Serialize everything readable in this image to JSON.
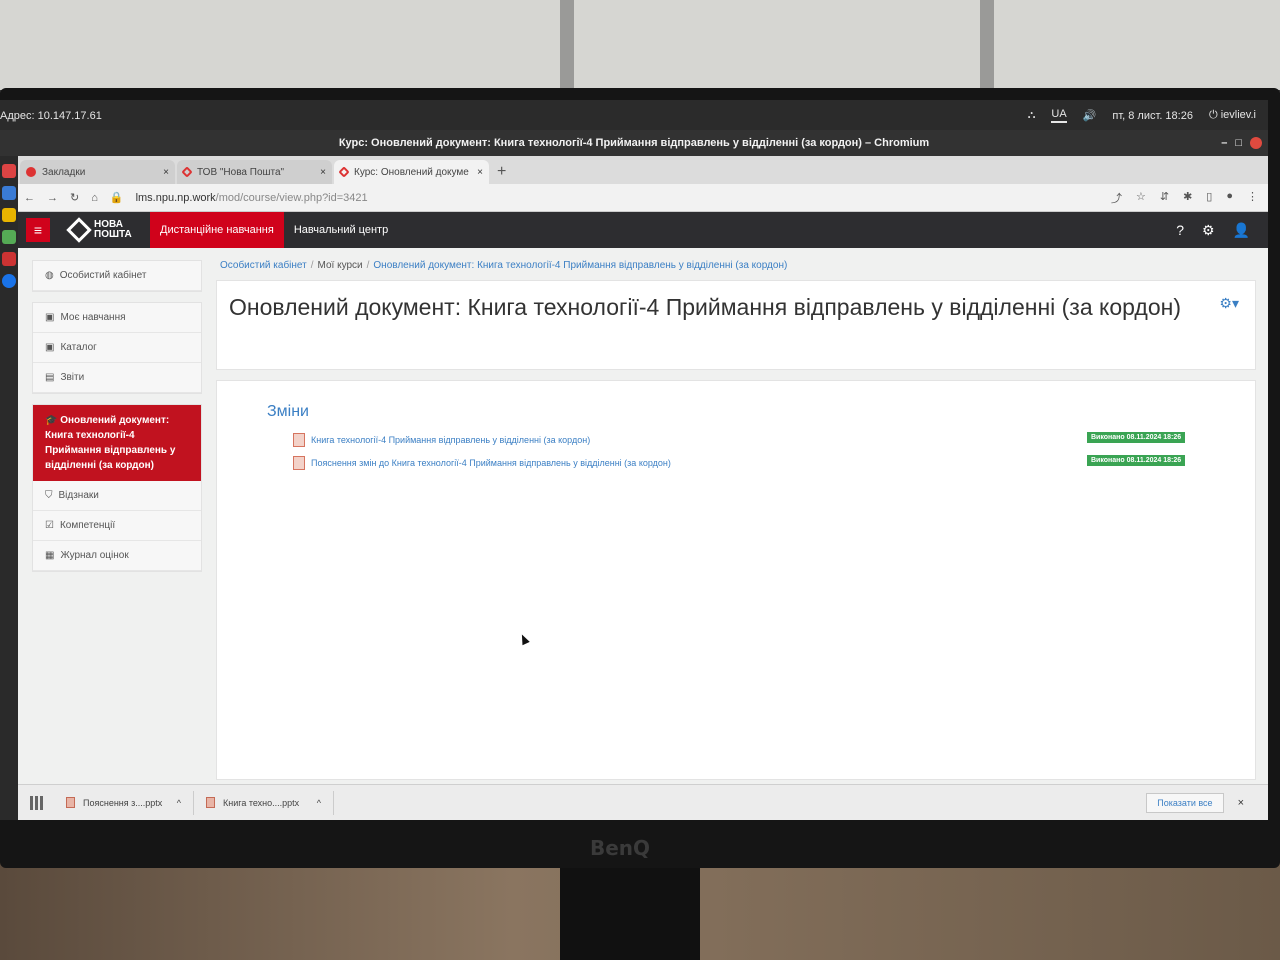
{
  "os": {
    "address": "Адрес: 10.147.17.61",
    "lang": "UA",
    "datetime": "пт, 8 лист. 18:26",
    "user": "ievliev.i"
  },
  "window": {
    "title": "Курс: Оновлений документ: Книга технології-4 Приймання відправлень у відділенні (за кордон) – Chromium"
  },
  "tabs": [
    {
      "label": "Закладки",
      "close": "×"
    },
    {
      "label": "ТОВ \"Нова Пошта\"",
      "close": "×"
    },
    {
      "label": "Курс: Оновлений докуме",
      "close": "×"
    }
  ],
  "new_tab": "+",
  "url": {
    "host": "lms.npu.np.work",
    "path": "/mod/course/view.php?id=3421"
  },
  "header": {
    "menu_icon": "≡",
    "logo_line1": "НОВА",
    "logo_line2": "ПОШТА",
    "nav": [
      "Дистанційне навчання",
      "Навчальний центр"
    ]
  },
  "sidebar": {
    "top": [
      {
        "label": "Особистий кабінет"
      }
    ],
    "section": [
      {
        "label": "Моє навчання"
      },
      {
        "label": "Каталог"
      },
      {
        "label": "Звіти"
      }
    ],
    "active": "Оновлений документ: Книга технології-4 Приймання відправлень у відділенні (за кордон)",
    "course": [
      {
        "label": "Відзнаки"
      },
      {
        "label": "Компетенції"
      },
      {
        "label": "Журнал оцінок"
      }
    ]
  },
  "breadcrumb": {
    "home": "Особистий кабінет",
    "my_courses": "Мої курси",
    "current": "Оновлений документ: Книга технології-4 Приймання відправлень у відділенні (за кордон)"
  },
  "page_title": "Оновлений документ: Книга технології-4 Приймання відправлень у відділенні (за кордон)",
  "section": {
    "title": "Зміни",
    "activities": [
      {
        "label": "Книга технології-4 Приймання відправлень у відділенні (за кордон)",
        "status": "Виконано 08.11.2024 18:26"
      },
      {
        "label": "Пояснення змін до Книга технології-4 Приймання відправлень у відділенні (за кордон)",
        "status": "Виконано 08.11.2024 18:26"
      }
    ]
  },
  "downloads": {
    "items": [
      {
        "name": "Пояснення з....pptx"
      },
      {
        "name": "Книга техно....pptx"
      }
    ],
    "show_all": "Показати все",
    "close": "×"
  },
  "monitor_brand": "BenQ",
  "colors": {
    "brand_red": "#d0021b",
    "link_blue": "#3b7fc4",
    "done_green": "#3aa453",
    "header_dark": "#2d2d30"
  }
}
